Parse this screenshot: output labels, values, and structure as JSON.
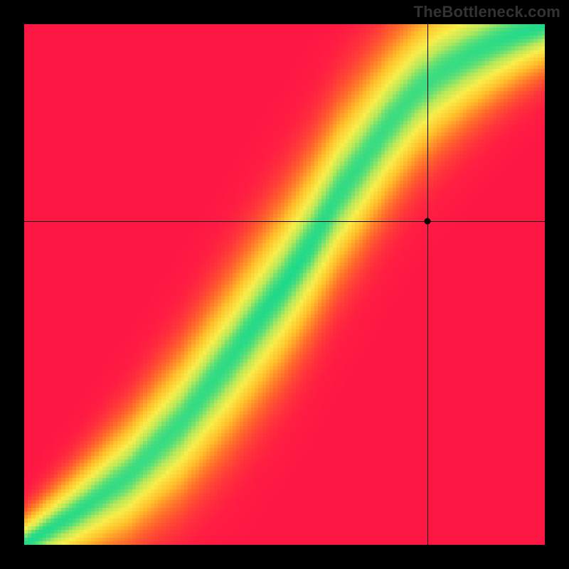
{
  "watermark": "TheBottleneck.com",
  "chart_data": {
    "type": "heatmap",
    "title": "",
    "xlabel": "",
    "ylabel": "",
    "xlim": [
      0,
      1
    ],
    "ylim": [
      0,
      1
    ],
    "grid": false,
    "legend": false,
    "resolution": 140,
    "ridge": {
      "comment": "Approximate center of the green optimal band (x normalized 0..1, y normalized 0..1)",
      "points": [
        [
          0.0,
          0.0
        ],
        [
          0.1,
          0.06
        ],
        [
          0.2,
          0.13
        ],
        [
          0.3,
          0.23
        ],
        [
          0.4,
          0.36
        ],
        [
          0.5,
          0.5
        ],
        [
          0.55,
          0.58
        ],
        [
          0.6,
          0.67
        ],
        [
          0.65,
          0.74
        ],
        [
          0.7,
          0.81
        ],
        [
          0.75,
          0.87
        ],
        [
          0.8,
          0.91
        ],
        [
          0.85,
          0.94
        ],
        [
          0.9,
          0.965
        ],
        [
          0.95,
          0.985
        ],
        [
          1.0,
          1.0
        ]
      ]
    },
    "color_stops": [
      {
        "t": 0.0,
        "hex": "#ff1744"
      },
      {
        "t": 0.25,
        "hex": "#ff6a2a"
      },
      {
        "t": 0.5,
        "hex": "#ffbf2a"
      },
      {
        "t": 0.72,
        "hex": "#f8ee4a"
      },
      {
        "t": 0.86,
        "hex": "#b8e85a"
      },
      {
        "t": 1.0,
        "hex": "#1ed98a"
      }
    ],
    "marker": {
      "x": 0.775,
      "y": 0.622
    },
    "crosshair": {
      "x": 0.775,
      "y": 0.622
    }
  }
}
